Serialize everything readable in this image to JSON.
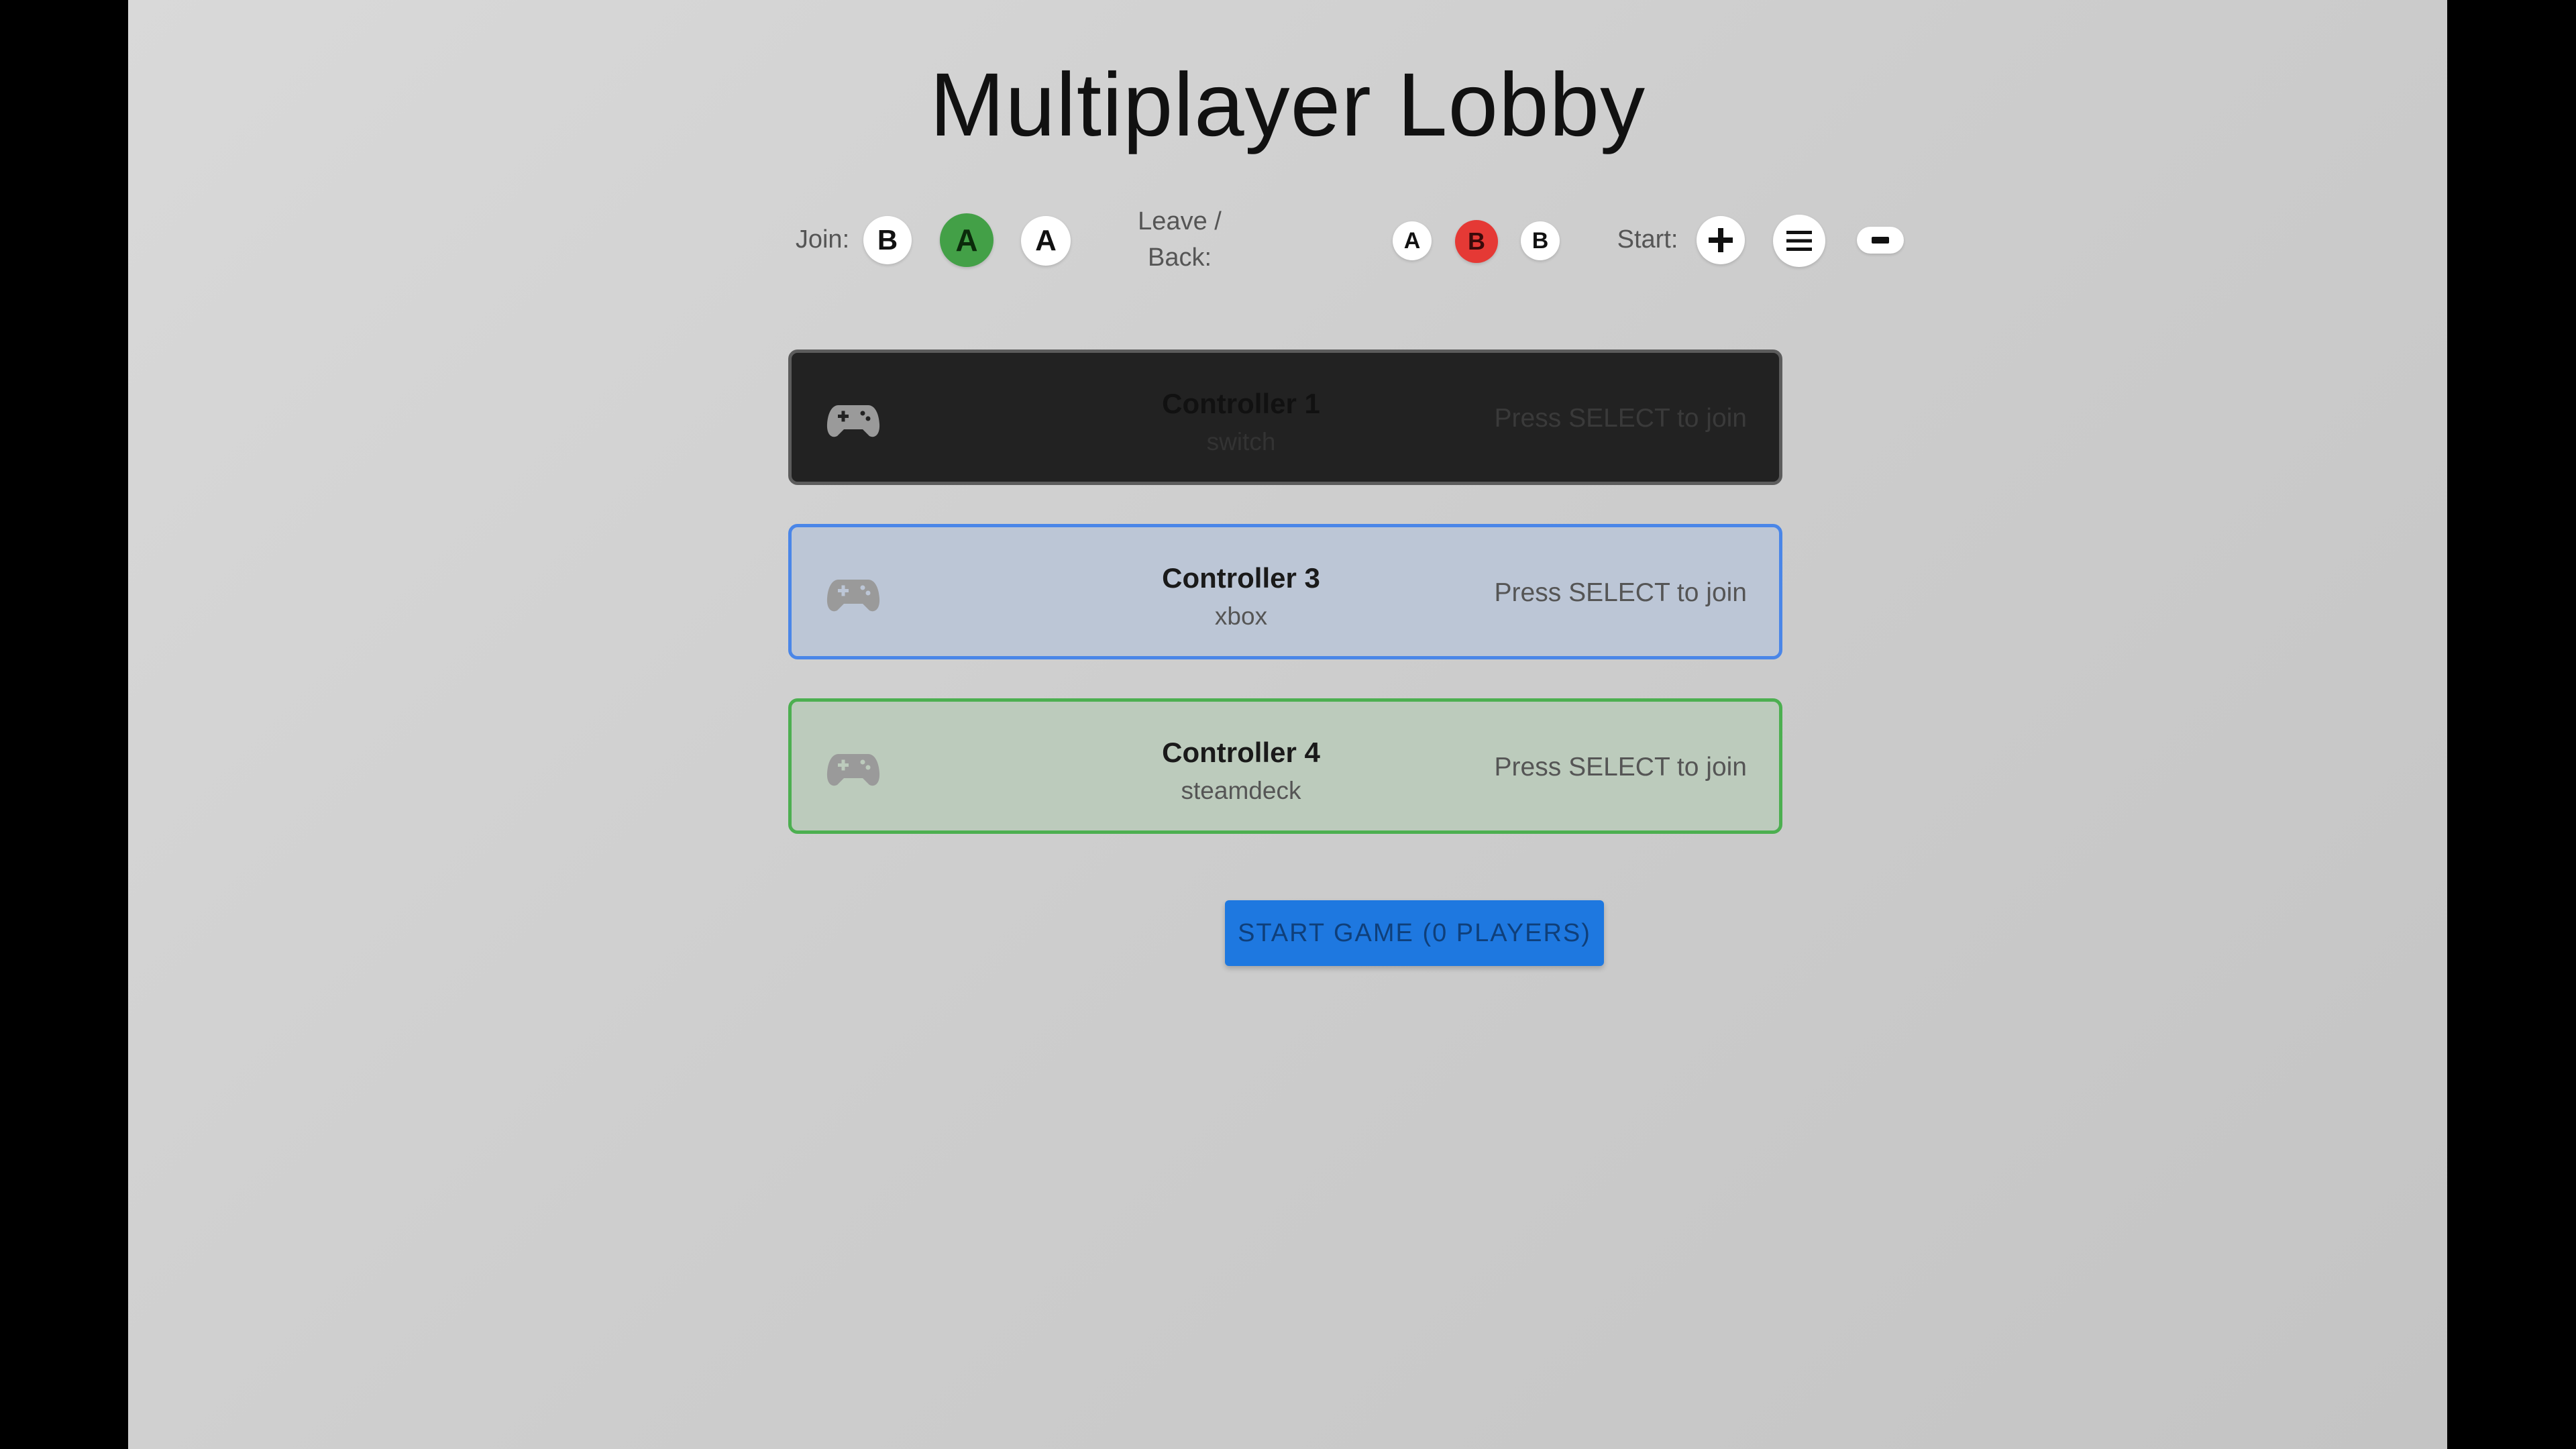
{
  "title": "Multiplayer Lobby",
  "hints": {
    "join": {
      "label": "Join:",
      "buttons": [
        {
          "glyph": "B",
          "color": "#ffffff",
          "text_color": "#111111"
        },
        {
          "glyph": "A",
          "color": "#43a047",
          "text_color": "#0b2a0b"
        },
        {
          "glyph": "A",
          "color": "#ffffff",
          "text_color": "#111111"
        }
      ]
    },
    "leave": {
      "label_line1": "Leave /",
      "label_line2": "Back:",
      "buttons": [
        {
          "glyph": "A",
          "color": "#ffffff",
          "text_color": "#111111"
        },
        {
          "glyph": "B",
          "color": "#e53935",
          "text_color": "#3a0a0a"
        },
        {
          "glyph": "B",
          "color": "#ffffff",
          "text_color": "#111111"
        }
      ]
    },
    "start": {
      "label": "Start:",
      "buttons": [
        {
          "icon": "plus-icon"
        },
        {
          "icon": "menu-icon"
        },
        {
          "icon": "view-icon"
        }
      ]
    }
  },
  "controllers": [
    {
      "name": "Controller 1",
      "type": "switch",
      "prompt": "Press SELECT to join",
      "icon": "gamepad-icon",
      "accent": "#5c5c5c"
    },
    {
      "name": "Controller 3",
      "type": "xbox",
      "prompt": "Press SELECT to join",
      "icon": "gamepad-icon",
      "accent": "#4a86e8"
    },
    {
      "name": "Controller 4",
      "type": "steamdeck",
      "prompt": "Press SELECT to join",
      "icon": "gamepad-icon",
      "accent": "#4caf50"
    }
  ],
  "start_button": {
    "label": "START GAME (0 PLAYERS)",
    "color": "#1e78e0"
  }
}
